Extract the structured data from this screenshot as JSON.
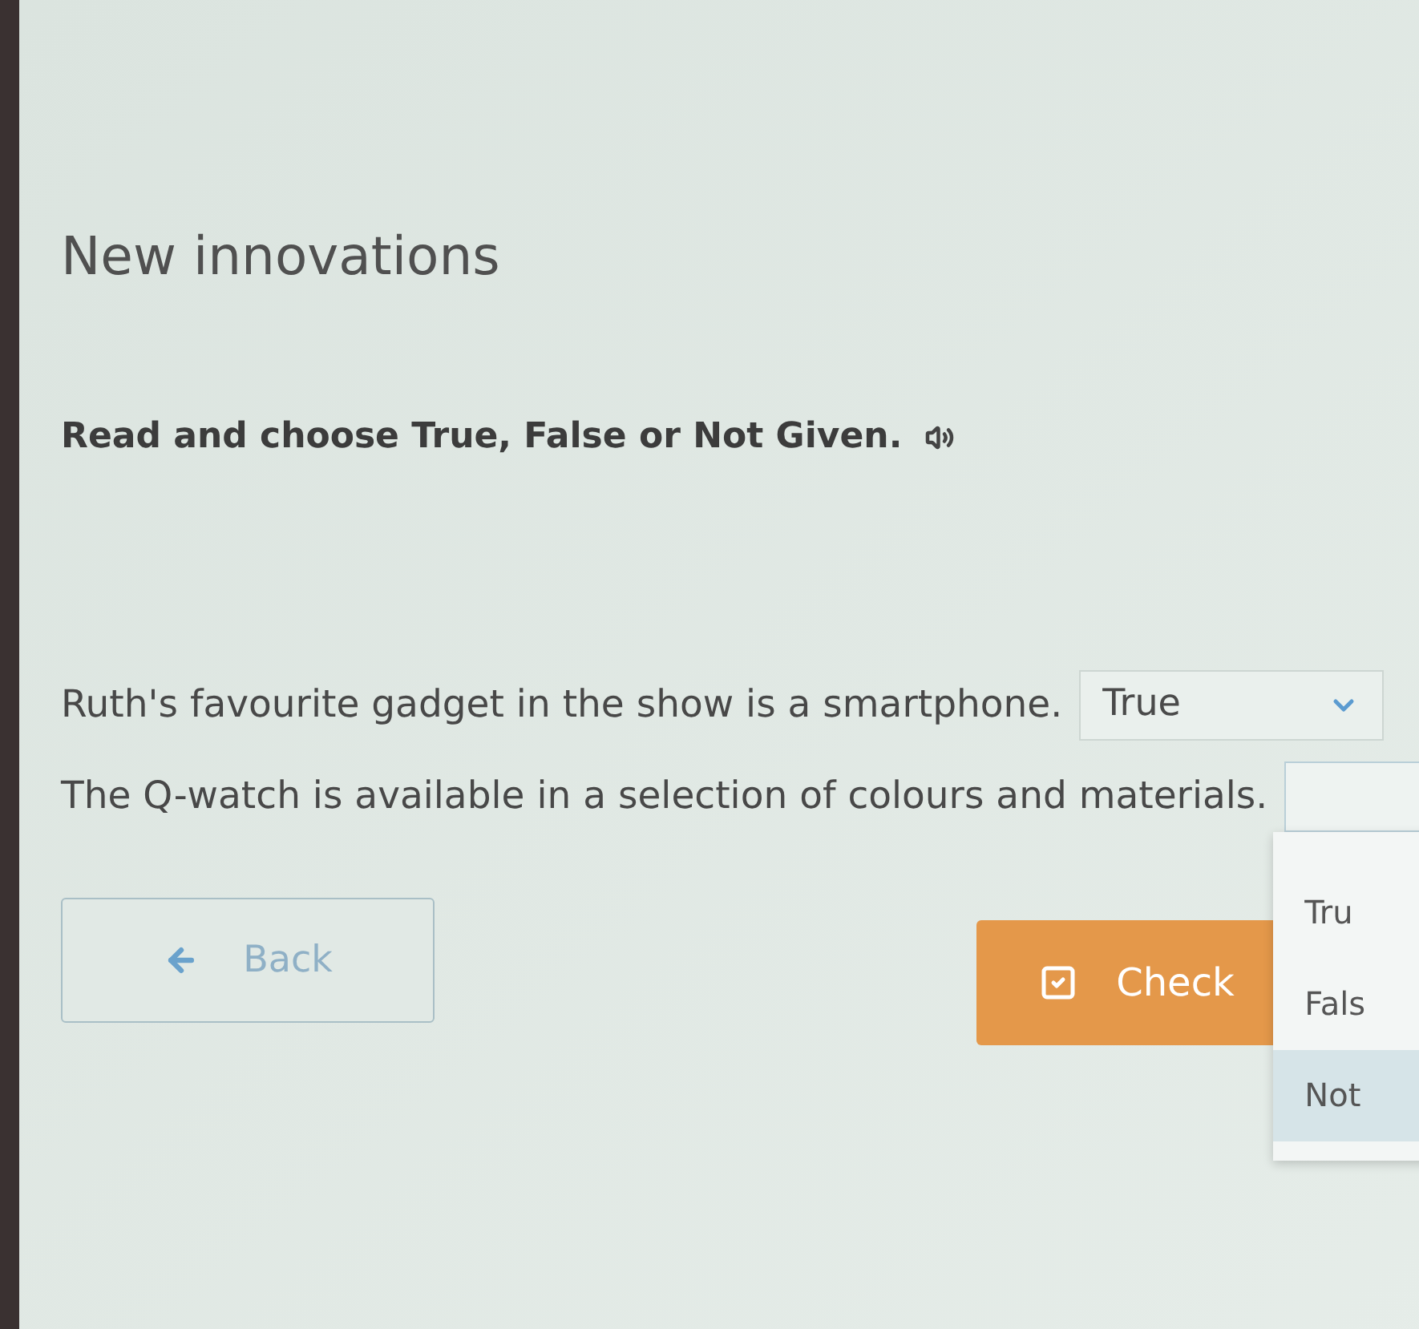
{
  "heading": "New innovations",
  "instruction": {
    "text": "Read and choose True, False or Not Given."
  },
  "questions": [
    {
      "sentence": "Ruth's favourite gadget in the show is a smartphone.",
      "answer": "True",
      "expanded": false
    },
    {
      "sentence": "The Q-watch is available in a selection of colours and materials.",
      "expanded": true,
      "options": [
        {
          "label": "Tru",
          "selected": false
        },
        {
          "label": "Fals",
          "selected": false
        },
        {
          "label": "Not",
          "selected": true
        }
      ]
    }
  ],
  "buttons": [
    {
      "kind": "back",
      "label": "Back"
    },
    {
      "kind": "check",
      "label": "Check"
    }
  ]
}
